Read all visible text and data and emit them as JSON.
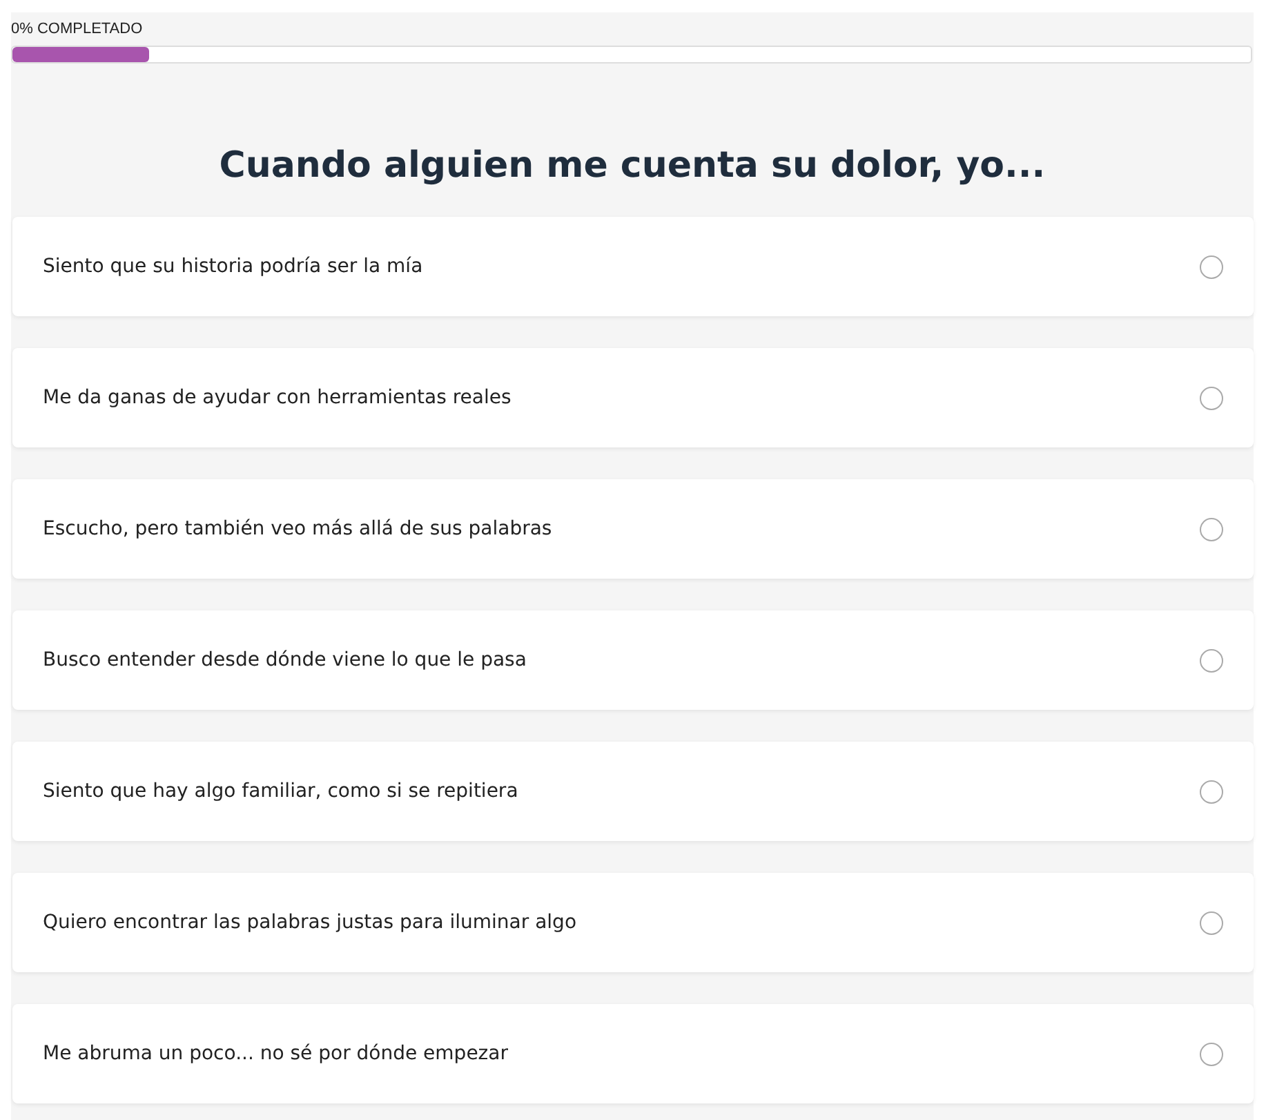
{
  "progress": {
    "label": "0% COMPLETADO",
    "level": 0.11
  },
  "question": {
    "title": "Cuando alguien me cuenta su dolor, yo...",
    "options": [
      {
        "text": "Siento que su historia podría ser la mía",
        "selected": false
      },
      {
        "text": "Me da ganas de ayudar con herramientas reales",
        "selected": false
      },
      {
        "text": "Escucho, pero también veo más allá de sus palabras",
        "selected": false
      },
      {
        "text": "Busco entender desde dónde viene lo que le pasa",
        "selected": false
      },
      {
        "text": "Siento que hay algo familiar, como si se repitiera",
        "selected": false
      },
      {
        "text": "Quiero encontrar las palabras justas para iluminar algo",
        "selected": false
      },
      {
        "text": "Me abruma un poco... no sé por dónde empezar",
        "selected": false
      }
    ]
  }
}
